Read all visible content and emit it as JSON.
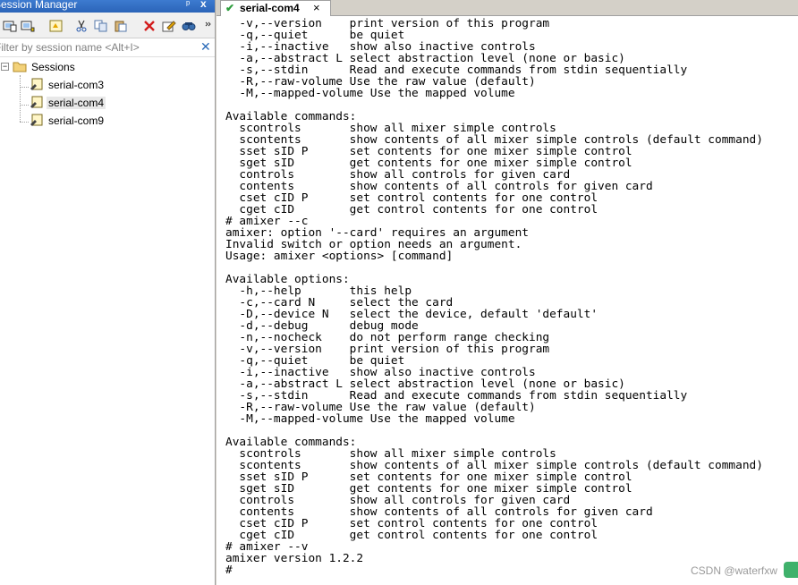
{
  "session_manager": {
    "title": "Session Manager",
    "pin_glyph": "ᵖ",
    "close_glyph": "x",
    "toolbar_icons": [
      "connect-icon",
      "new-session-icon",
      "properties-icon",
      "cut-icon",
      "copy-icon",
      "paste-icon",
      "delete-icon",
      "edit-icon",
      "find-icon"
    ],
    "filter_placeholder": "Filter by session name <Alt+I>",
    "filter_clear_glyph": "✕",
    "root_expander": "−",
    "root_label": "Sessions",
    "sessions": [
      "serial-com3",
      "serial-com4",
      "serial-com9"
    ],
    "selected_session": "serial-com4"
  },
  "tabs": [
    {
      "label": "serial-com4",
      "status_icon": "connected-check-icon",
      "status_glyph": "✔",
      "close_glyph": "×",
      "active": true
    }
  ],
  "terminal": {
    "lines": [
      "  -v,--version    print version of this program",
      "  -q,--quiet      be quiet",
      "  -i,--inactive   show also inactive controls",
      "  -a,--abstract L select abstraction level (none or basic)",
      "  -s,--stdin      Read and execute commands from stdin sequentially",
      "  -R,--raw-volume Use the raw value (default)",
      "  -M,--mapped-volume Use the mapped volume",
      "",
      "Available commands:",
      "  scontrols       show all mixer simple controls",
      "  scontents       show contents of all mixer simple controls (default command)",
      "  sset sID P      set contents for one mixer simple control",
      "  sget sID        get contents for one mixer simple control",
      "  controls        show all controls for given card",
      "  contents        show contents of all controls for given card",
      "  cset cID P      set control contents for one control",
      "  cget cID        get control contents for one control",
      "# amixer --c",
      "amixer: option '--card' requires an argument",
      "Invalid switch or option needs an argument.",
      "Usage: amixer <options> [command]",
      "",
      "Available options:",
      "  -h,--help       this help",
      "  -c,--card N     select the card",
      "  -D,--device N   select the device, default 'default'",
      "  -d,--debug      debug mode",
      "  -n,--nocheck    do not perform range checking",
      "  -v,--version    print version of this program",
      "  -q,--quiet      be quiet",
      "  -i,--inactive   show also inactive controls",
      "  -a,--abstract L select abstraction level (none or basic)",
      "  -s,--stdin      Read and execute commands from stdin sequentially",
      "  -R,--raw-volume Use the raw value (default)",
      "  -M,--mapped-volume Use the mapped volume",
      "",
      "Available commands:",
      "  scontrols       show all mixer simple controls",
      "  scontents       show contents of all mixer simple controls (default command)",
      "  sset sID P      set contents for one mixer simple control",
      "  sget sID        get contents for one mixer simple control",
      "  controls        show all controls for given card",
      "  contents        show contents of all controls for given card",
      "  cset cID P      set control contents for one control",
      "  cget cID        get control contents for one control",
      "# amixer --v",
      "amixer version 1.2.2",
      "# "
    ]
  },
  "watermark": "CSDN @waterfxw",
  "colors": {
    "title_bar": "#2b64b8",
    "tab_check": "#2e9e3e",
    "badge": "#3fb16b"
  }
}
